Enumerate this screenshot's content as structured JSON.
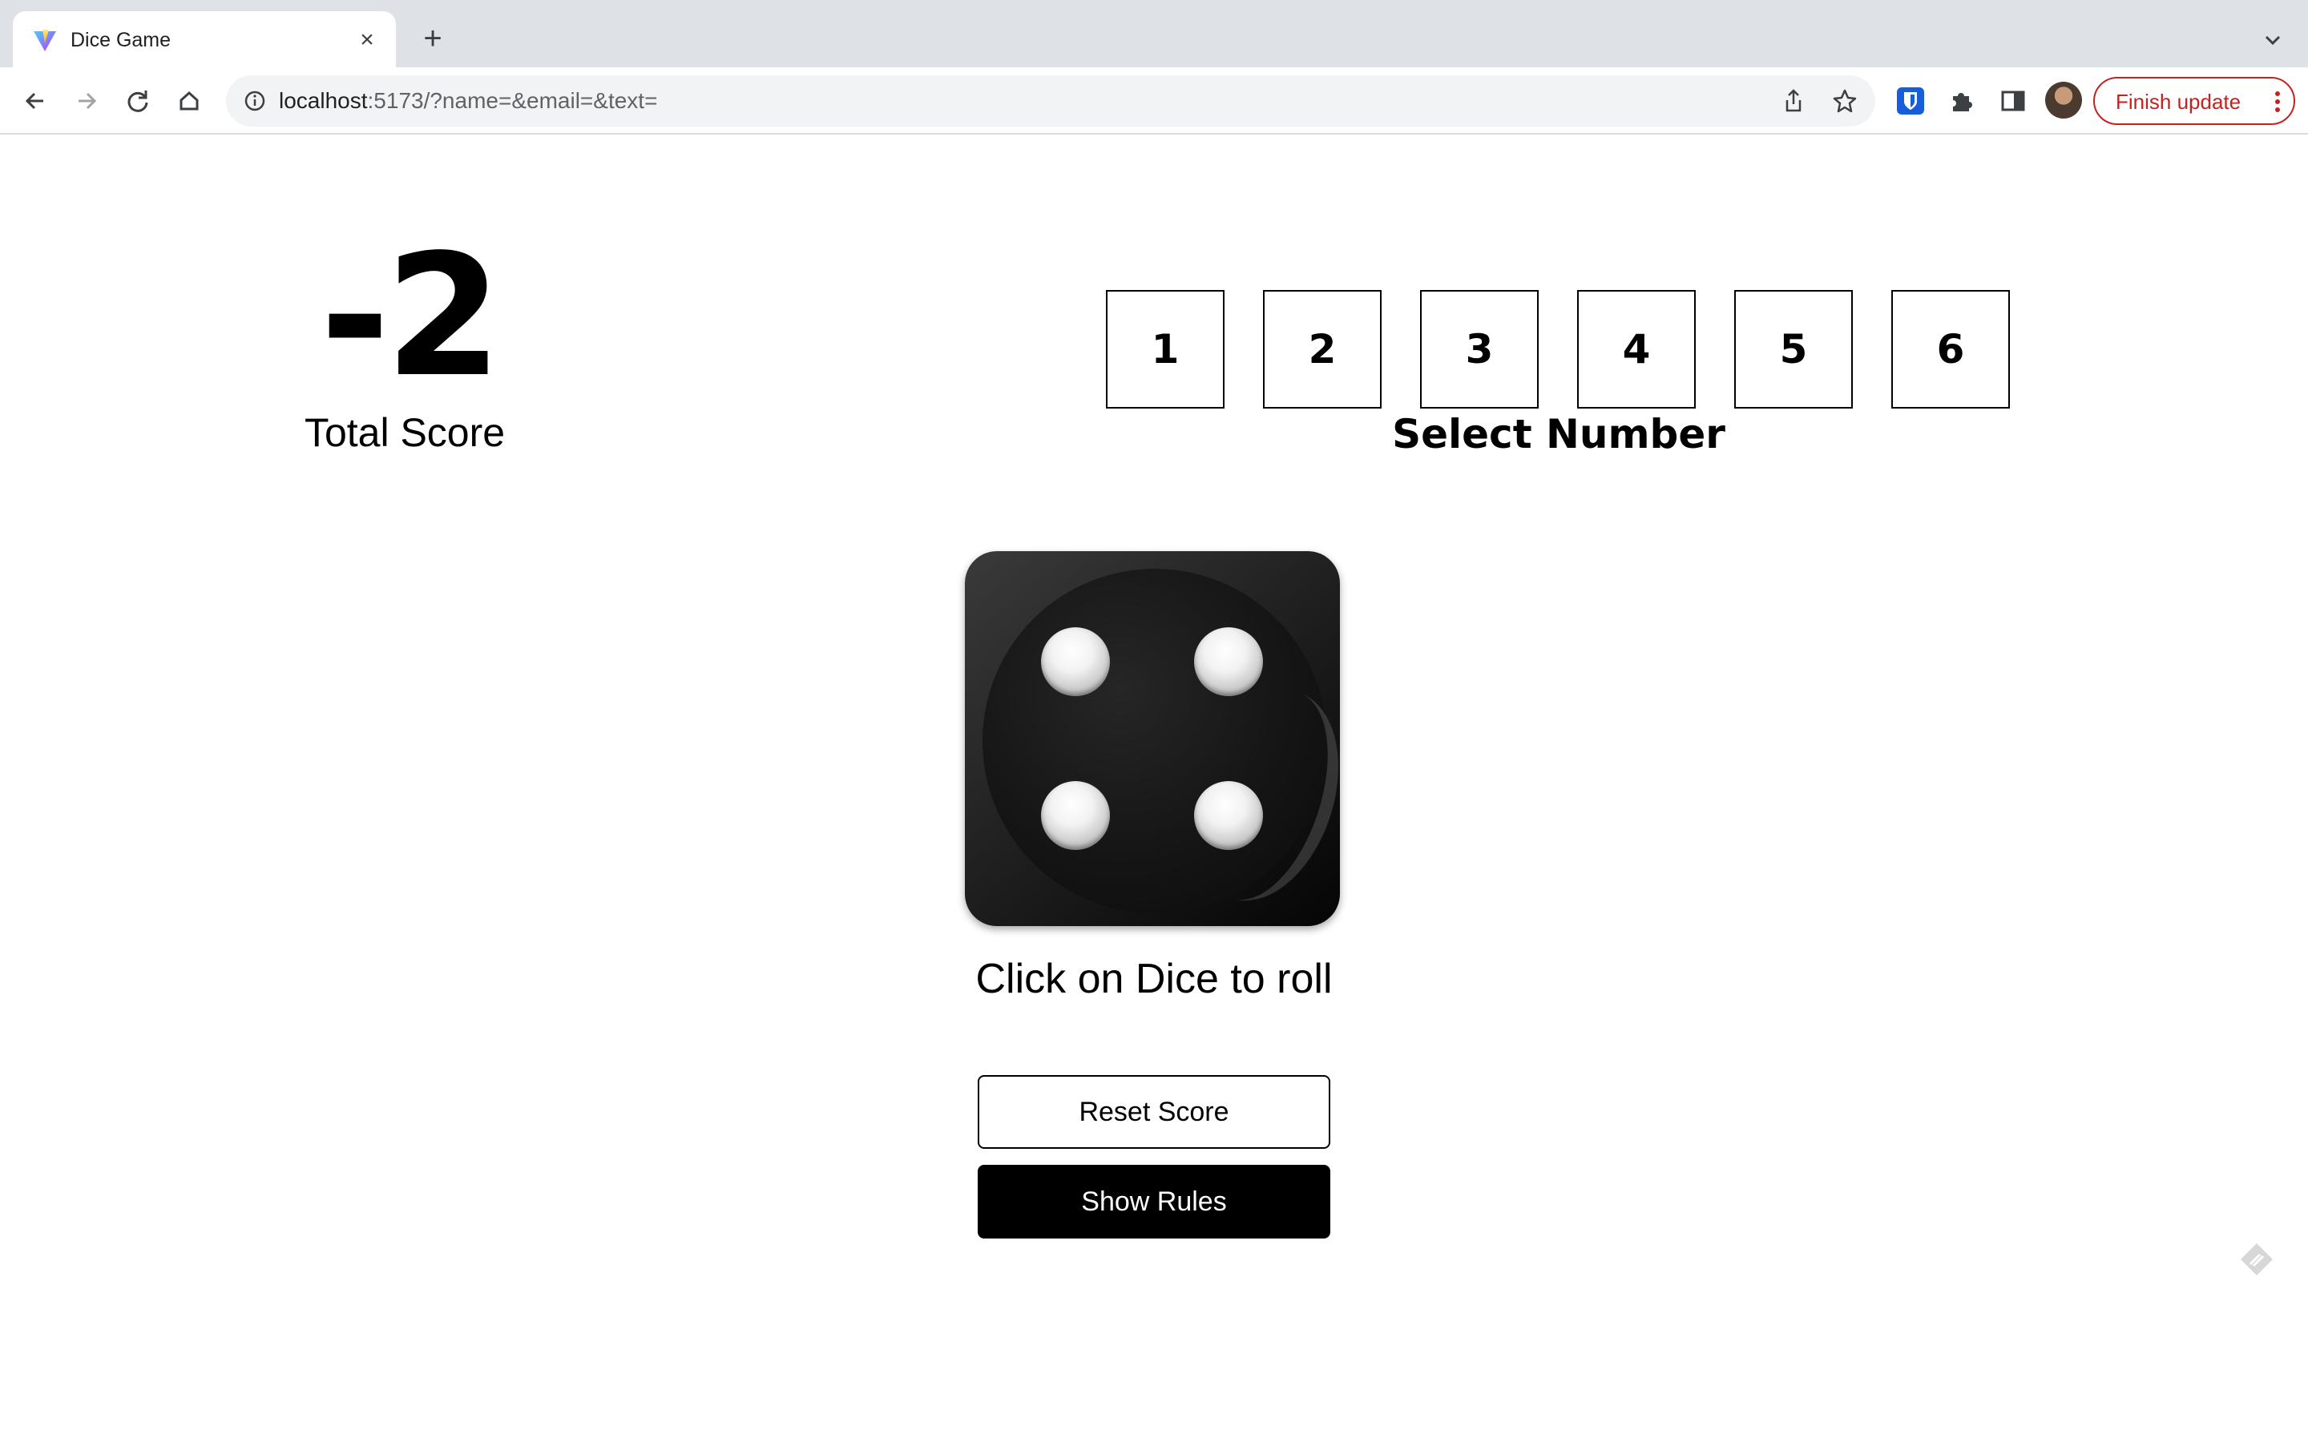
{
  "browser": {
    "tab_title": "Dice Game",
    "tab_favicon": "vite-logo-icon",
    "url_host": "localhost",
    "url_rest": ":5173/?name=&email=&text=",
    "update_label": "Finish update",
    "accent_color": "#c5221f"
  },
  "game": {
    "total_score": "-2",
    "total_score_label": "Total Score",
    "select_label": "Select Number",
    "numbers": [
      "1",
      "2",
      "3",
      "4",
      "5",
      "6"
    ],
    "dice_value": 4,
    "roll_hint": "Click on Dice to roll",
    "reset_label": "Reset Score",
    "rules_label": "Show Rules"
  }
}
